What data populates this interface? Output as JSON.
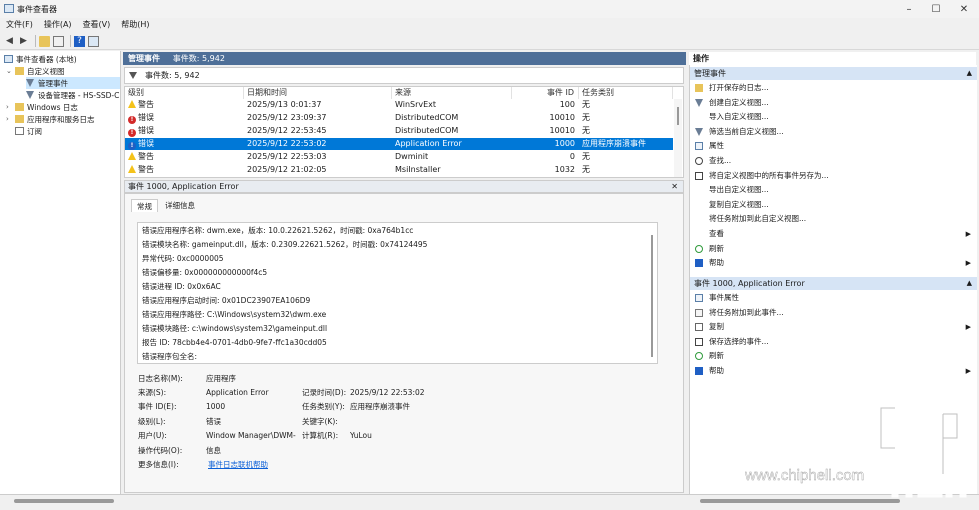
{
  "window": {
    "title": "事件查看器"
  },
  "menu": [
    "文件(F)",
    "操作(A)",
    "查看(V)",
    "帮助(H)"
  ],
  "tree": {
    "items": [
      {
        "label": "事件查看器 (本地)"
      },
      {
        "label": "自定义视图"
      },
      {
        "label": "管理事件"
      },
      {
        "label": "设备管理器 - HS-SSD-C"
      },
      {
        "label": "Windows 日志"
      },
      {
        "label": "应用程序和服务日志"
      },
      {
        "label": "订阅"
      }
    ]
  },
  "middle": {
    "header_title": "管理事件",
    "header_count": "事件数: 5,942",
    "filter_text": "事件数:  5, 942",
    "columns": [
      "级别",
      "日期和时间",
      "来源",
      "事件 ID",
      "任务类别"
    ],
    "rows": [
      {
        "level": "警告",
        "type": "warn",
        "datetime": "2025/9/13 0:01:37",
        "source": "WinSrvExt",
        "id": "100",
        "task": "无"
      },
      {
        "level": "错误",
        "type": "err",
        "datetime": "2025/9/12 23:09:37",
        "source": "DistributedCOM",
        "id": "10010",
        "task": "无"
      },
      {
        "level": "错误",
        "type": "err",
        "datetime": "2025/9/12 22:53:45",
        "source": "DistributedCOM",
        "id": "10010",
        "task": "无"
      },
      {
        "level": "错误",
        "type": "info",
        "datetime": "2025/9/12 22:53:02",
        "source": "Application Error",
        "id": "1000",
        "task": "应用程序崩溃事件"
      },
      {
        "level": "警告",
        "type": "warn",
        "datetime": "2025/9/12 22:53:03",
        "source": "Dwminit",
        "id": "0",
        "task": "无"
      },
      {
        "level": "警告",
        "type": "warn",
        "datetime": "2025/9/12 21:02:05",
        "source": "MsiInstaller",
        "id": "1032",
        "task": "无"
      }
    ],
    "detail_title": "事件 1000, Application Error",
    "tabs": [
      "常规",
      "详细信息"
    ],
    "message_lines": [
      "错误应用程序名称: dwm.exe，版本: 10.0.22621.5262，时间戳: 0xa764b1cc",
      "错误模块名称: gameinput.dll，版本: 0.2309.22621.5262，时间戳: 0x74124495",
      "异常代码: 0xc0000005",
      "错误偏移量: 0x000000000000f4c5",
      "错误进程 ID: 0x0x6AC",
      "错误应用程序启动时间: 0x01DC23907EA106D9",
      "错误应用程序路径: C:\\Windows\\system32\\dwm.exe",
      "错误模块路径: c:\\windows\\system32\\gameinput.dll",
      "报告 ID: 78cbb4e4-0701-4db0-9fe7-ffc1a30cdd05",
      "错误程序包全名:"
    ],
    "fields": {
      "log_name_label": "日志名称(M):",
      "log_name": "应用程序",
      "source_label": "来源(S):",
      "source": "Application Error",
      "recorded_label": "记录时间(D):",
      "recorded": "2025/9/12 22:53:02",
      "event_id_label": "事件 ID(E):",
      "event_id": "1000",
      "task_label": "任务类别(Y):",
      "task": "应用程序崩溃事件",
      "level_label": "级别(L):",
      "level": "错误",
      "keywords_label": "关键字(K):",
      "user_label": "用户(U):",
      "user": "Window Manager\\DWM-",
      "computer_label": "计算机(R):",
      "computer": "YuLou",
      "opcode_label": "操作代码(O):",
      "opcode": "信息",
      "more_label": "更多信息(I):",
      "more_link": "事件日志联机帮助"
    }
  },
  "actions": {
    "title": "操作",
    "section1": "管理事件",
    "items1": [
      {
        "label": "打开保存的日志...",
        "icon": "folder-icon"
      },
      {
        "label": "创建自定义视图...",
        "icon": "filter-icon"
      },
      {
        "label": "导入自定义视图...",
        "icon": "none"
      },
      {
        "label": "筛选当前自定义视图...",
        "icon": "filter-icon"
      },
      {
        "label": "属性",
        "icon": "properties-icon"
      },
      {
        "label": "查找...",
        "icon": "find-icon"
      },
      {
        "label": "将自定义视图中的所有事件另存为...",
        "icon": "save-icon"
      },
      {
        "label": "导出自定义视图...",
        "icon": "none"
      },
      {
        "label": "复制自定义视图...",
        "icon": "none"
      },
      {
        "label": "将任务附加到此自定义视图...",
        "icon": "none"
      },
      {
        "label": "查看",
        "icon": "none"
      },
      {
        "label": "刷新",
        "icon": "refresh-icon"
      },
      {
        "label": "帮助",
        "icon": "help-icon"
      }
    ],
    "section2": "事件 1000, Application Error",
    "items2": [
      {
        "label": "事件属性",
        "icon": "properties-icon"
      },
      {
        "label": "将任务附加到此事件...",
        "icon": "task-icon"
      },
      {
        "label": "复制",
        "icon": "copy-icon"
      },
      {
        "label": "保存选择的事件...",
        "icon": "save-icon"
      },
      {
        "label": "刷新",
        "icon": "refresh-icon"
      },
      {
        "label": "帮助",
        "icon": "help-icon"
      }
    ]
  },
  "watermark": {
    "text": "www.chiphell.com",
    "logo_text": "chip hell"
  },
  "colors": {
    "accent": "#0078d7",
    "header": "#4e6f98",
    "section": "#d6e4f5"
  }
}
